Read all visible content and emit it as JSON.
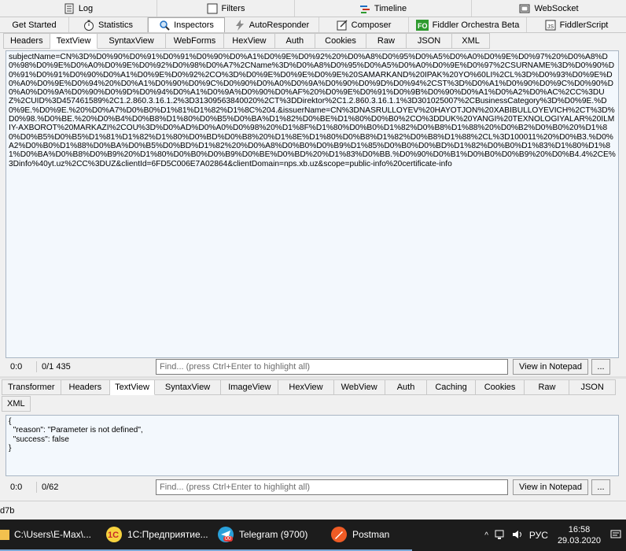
{
  "top_tabs_row1": [
    {
      "label": "Log",
      "icon": "log-icon"
    },
    {
      "label": "Filters",
      "icon": "filters-icon"
    },
    {
      "label": "Timeline",
      "icon": "timeline-icon"
    },
    {
      "label": "WebSocket",
      "icon": "websocket-icon"
    }
  ],
  "top_tabs_row2": [
    {
      "label": "Get Started"
    },
    {
      "label": "Statistics",
      "icon": "stopwatch-icon"
    },
    {
      "label": "Inspectors",
      "icon": "inspectors-icon",
      "active": true
    },
    {
      "label": "AutoResponder",
      "icon": "lightning-icon"
    },
    {
      "label": "Composer",
      "icon": "composer-icon"
    },
    {
      "label": "Fiddler Orchestra Beta",
      "icon": "orchestra-icon"
    },
    {
      "label": "FiddlerScript",
      "icon": "script-icon"
    }
  ],
  "request_tabs": [
    "Headers",
    "TextView",
    "SyntaxView",
    "WebForms",
    "HexView",
    "Auth",
    "Cookies",
    "Raw",
    "JSON",
    "XML"
  ],
  "request_active": "TextView",
  "request_body": "subjectName=CN%3D%D0%90%D0%91%D0%91%D0%90%D0%A1%D0%9E%D0%92%20%D0%A8%D0%95%D0%A5%D0%A0%D0%9E%D0%97%20%D0%A8%D0%98%D0%9E%D0%A0%D0%9E%D0%92%D0%98%D0%A7%2CName%3D%D0%A8%D0%95%D0%A5%D0%A0%D0%9E%D0%97%2CSURNAME%3D%D0%90%D0%91%D0%91%D0%90%D0%A1%D0%9E%D0%92%2CO%3D%D0%9E%D0%9E%D0%9E%20SAMARKAND%20IPAK%20YO%60LI%2CL%3D%D0%93%D0%9E%D0%A0%D0%9E%D0%94%20%D0%A1%D0%90%D0%9C%D0%90%D0%A0%D0%9A%D0%90%D0%9D%D0%94%2CST%3D%D0%A1%D0%90%D0%9C%D0%90%D0%A0%D0%9A%D0%90%D0%9D%D0%94%D0%A1%D0%9A%D0%90%D0%AF%20%D0%9E%D0%91%D0%9B%D0%90%D0%A1%D0%A2%D0%AC%2CC%3DUZ%2CUID%3D457461589%2C1.2.860.3.16.1.2%3D31309563840020%2CT%3DDirektor%2C1.2.860.3.16.1.1%3D301025007%2CBusinessCategory%3D%D0%9E.%D0%9E.%D0%9E.%20%D0%A7%D0%B0%D1%81%D1%82%D1%8C%204.&issuerName=CN%3DNASRULLOYEV%20HAYOTJON%20XABIBULLOYEVICH%2CT%3D%D0%98.%D0%BE.%20%D0%B4%D0%B8%D1%80%D0%B5%D0%BA%D1%82%D0%BE%D1%80%D0%B0%2CO%3DDUK%20YANGI%20TEXNOLOGIYALAR%20ILMIY-AXBOROT%20MARKAZI%2COU%3D%D0%AD%D0%A0%D0%98%20%D1%8F%D1%80%D0%B0%D1%82%D0%B8%D1%88%20%D0%B2%D0%B0%20%D1%80%D0%B5%D0%B5%D1%81%D1%82%D1%80%D0%BD%D0%B8%20%D1%8E%D1%80%D0%B8%D1%82%D0%B8%D1%88%2CL%3D100011%20%D0%B3.%D0%A2%D0%B0%D1%88%D0%BA%D0%B5%D0%BD%D1%82%20%D0%A8%D0%B0%D0%B9%D1%85%D0%B0%D0%BD%D1%82%D0%B0%D1%83%D1%80%D1%81%D0%BA%D0%B8%D0%B9%20%D1%80%D0%B0%D0%B9%D0%BE%D0%BD%20%D1%83%D0%BB.%D0%90%D0%B1%D0%B0%D0%B9%20%D0%B4.4%2CE%3Dinfo%40yt.uz%2CC%3DUZ&clientId=6FD5C006E7A02864&clientDomain=nps.xb.uz&scope=public-info%20certificate-info",
  "request_status": {
    "pos": "0:0",
    "count": "0/1 435"
  },
  "find_placeholder": "Find... (press Ctrl+Enter to highlight all)",
  "view_notepad": "View in Notepad",
  "more_btn": "...",
  "response_tabs": [
    "Transformer",
    "Headers",
    "TextView",
    "SyntaxView",
    "ImageView",
    "HexView",
    "WebView",
    "Auth",
    "Caching",
    "Cookies",
    "Raw",
    "JSON"
  ],
  "response_tabs_row2": [
    "XML"
  ],
  "response_active": "TextView",
  "response_body": "{\n  \"reason\": \"Parameter is not defined\",\n  \"success\": false\n}",
  "response_status": {
    "pos": "0:0",
    "count": "0/62"
  },
  "bottom_strip": "d7b",
  "taskbar": {
    "items": [
      {
        "label": "C:\\Users\\E-Max\\...",
        "icon": "folder-icon"
      },
      {
        "label": "1С:Предприятие...",
        "icon": "1c-icon"
      },
      {
        "label": "Telegram (9700)",
        "icon": "telegram-icon",
        "badge": "00"
      },
      {
        "label": "Postman",
        "icon": "postman-icon"
      }
    ],
    "lang": "РУС",
    "time": "16:58",
    "date": "29.03.2020"
  },
  "colors": {
    "text_bg": "#f3f8fd",
    "accent": "#0078d7",
    "taskbar": "#1c1c1c"
  }
}
